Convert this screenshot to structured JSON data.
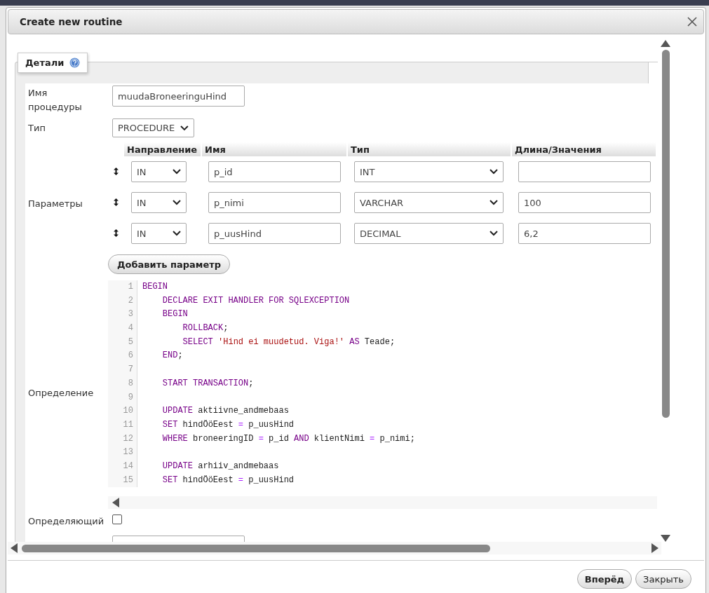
{
  "dialog": {
    "title": "Create new routine"
  },
  "details": {
    "legend": "Детали",
    "name_label": "Имя процедуры",
    "name_value": "muudaBroneeringuHind",
    "type_label": "Тип",
    "type_value": "PROCEDURE"
  },
  "parameters": {
    "label": "Параметры",
    "columns": [
      "Направление",
      "Имя",
      "Тип",
      "Длина/Значения"
    ],
    "rows": [
      {
        "direction": "IN",
        "name": "p_id",
        "type": "INT",
        "length": ""
      },
      {
        "direction": "IN",
        "name": "p_nimi",
        "type": "VARCHAR",
        "length": "100"
      },
      {
        "direction": "IN",
        "name": "p_uusHind",
        "type": "DECIMAL",
        "length": "6,2"
      }
    ],
    "add_button": "Добавить параметр"
  },
  "definition": {
    "label": "Определение",
    "lines": [
      {
        "number": "1",
        "tokens": [
          {
            "kind": "keyword",
            "text": "BEGIN"
          }
        ]
      },
      {
        "number": "2",
        "tokens": [
          {
            "kind": "keyword",
            "text": "    DECLARE EXIT HANDLER FOR SQLEXCEPTION"
          }
        ]
      },
      {
        "number": "3",
        "tokens": [
          {
            "kind": "keyword",
            "text": "    BEGIN"
          }
        ]
      },
      {
        "number": "4",
        "tokens": [
          {
            "kind": "keyword",
            "text": "        ROLLBACK"
          },
          {
            "kind": "plain",
            "text": ";"
          }
        ]
      },
      {
        "number": "5",
        "tokens": [
          {
            "kind": "keyword",
            "text": "        SELECT"
          },
          {
            "kind": "string",
            "text": " 'Hind ei muudetud. Viga!'"
          },
          {
            "kind": "keyword",
            "text": " AS"
          },
          {
            "kind": "plain",
            "text": " Teade;"
          }
        ]
      },
      {
        "number": "6",
        "tokens": [
          {
            "kind": "keyword",
            "text": "    END"
          },
          {
            "kind": "plain",
            "text": ";"
          }
        ]
      },
      {
        "number": "7"
      },
      {
        "number": "8",
        "tokens": [
          {
            "kind": "keyword",
            "text": "    START TRANSACTION"
          },
          {
            "kind": "plain",
            "text": ";"
          }
        ]
      },
      {
        "number": "9"
      },
      {
        "number": "10",
        "tokens": [
          {
            "kind": "keyword",
            "text": "    UPDATE"
          },
          {
            "kind": "plain",
            "text": " aktiivne_andmebaas"
          }
        ]
      },
      {
        "number": "11",
        "tokens": [
          {
            "kind": "keyword",
            "text": "    SET"
          },
          {
            "kind": "plain",
            "text": " hindÖöEest"
          },
          {
            "kind": "operator",
            "text": " ="
          },
          {
            "kind": "plain",
            "text": " p_uusHind"
          }
        ]
      },
      {
        "number": "12",
        "tokens": [
          {
            "kind": "keyword",
            "text": "    WHERE"
          },
          {
            "kind": "plain",
            "text": " broneeringID"
          },
          {
            "kind": "operator",
            "text": " ="
          },
          {
            "kind": "plain",
            "text": " p_id"
          },
          {
            "kind": "keyword",
            "text": " AND"
          },
          {
            "kind": "plain",
            "text": " klientNimi"
          },
          {
            "kind": "operator",
            "text": " ="
          },
          {
            "kind": "plain",
            "text": " p_nimi;"
          }
        ]
      },
      {
        "number": "13"
      },
      {
        "number": "14",
        "tokens": [
          {
            "kind": "keyword",
            "text": "    UPDATE"
          },
          {
            "kind": "plain",
            "text": " arhiiv_andmebaas"
          }
        ]
      },
      {
        "number": "15",
        "tokens": [
          {
            "kind": "keyword",
            "text": "    SET"
          },
          {
            "kind": "plain",
            "text": " hindÖöEest"
          },
          {
            "kind": "operator",
            "text": " ="
          },
          {
            "kind": "plain",
            "text": " p_uusHind"
          }
        ]
      }
    ]
  },
  "deterministic": {
    "label": "Определяющий",
    "checked": false
  },
  "buttons": [
    {
      "label": "Вперёд",
      "primary": true
    },
    {
      "label": "Закрыть",
      "primary": false
    }
  ]
}
